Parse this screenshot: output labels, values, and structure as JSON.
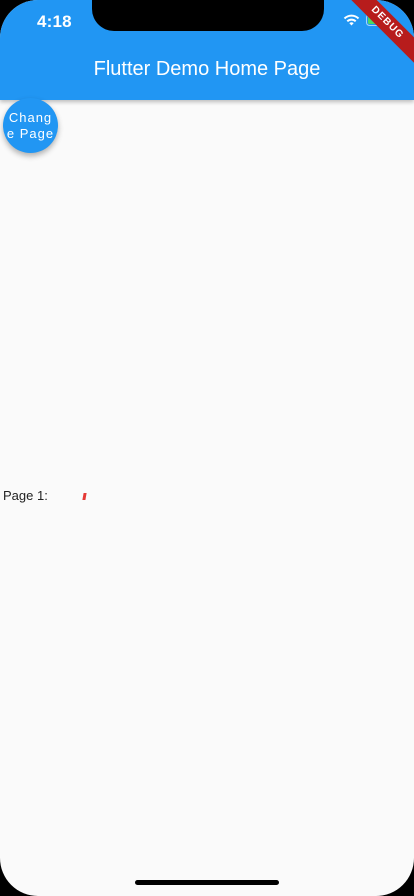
{
  "status_bar": {
    "time": "4:18",
    "icons": [
      "wifi-icon",
      "battery-icon"
    ]
  },
  "debug_banner": "DEBUG",
  "app_bar": {
    "title": "Flutter Demo Home Page",
    "color": "#2196f3"
  },
  "fab": {
    "label": "Change Page"
  },
  "content": {
    "page_label": "Page 1:"
  },
  "colors": {
    "primary": "#2196f3",
    "background": "#fafafa",
    "accent_mark": "#e53935"
  }
}
